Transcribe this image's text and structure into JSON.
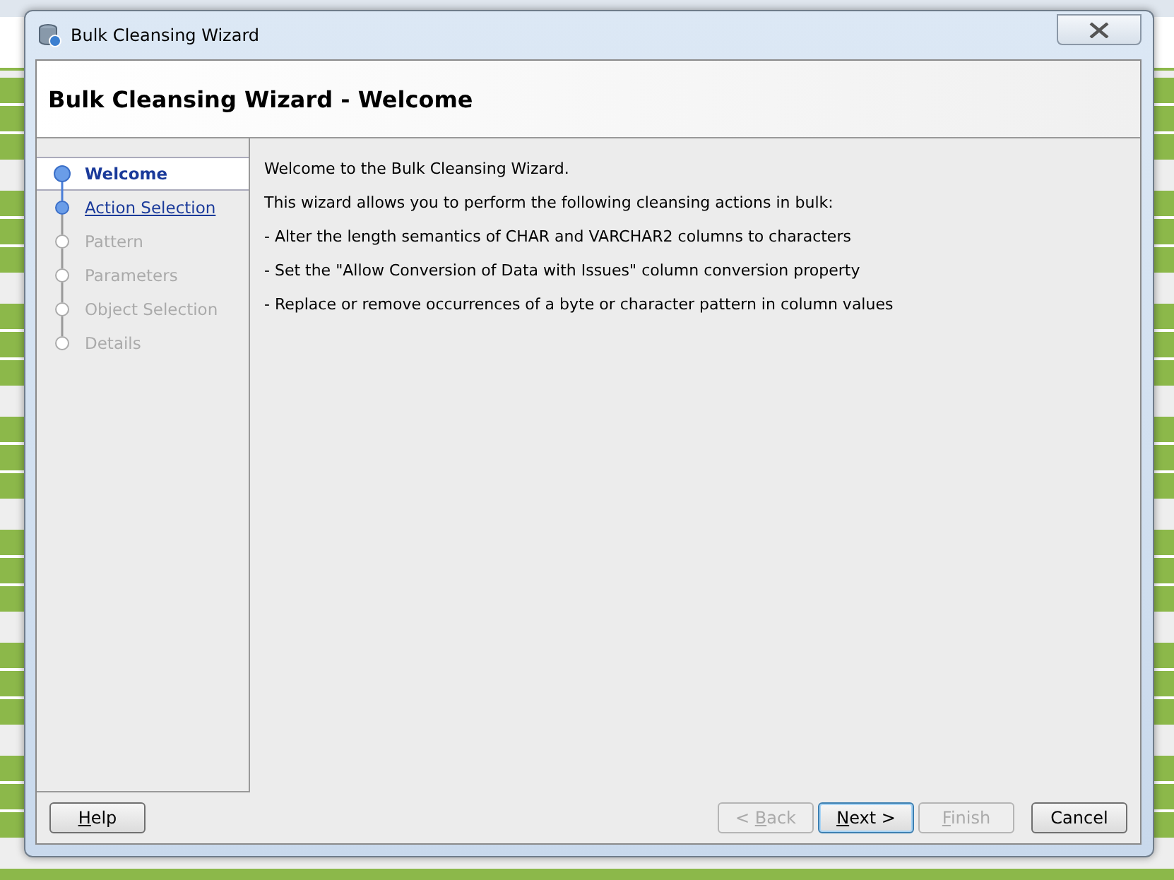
{
  "window": {
    "title": "Bulk Cleansing Wizard"
  },
  "header": {
    "title": "Bulk Cleansing Wizard - Welcome"
  },
  "steps": [
    {
      "label": "Welcome",
      "selected": true,
      "disabled": false
    },
    {
      "label": "Action Selection",
      "selected": false,
      "disabled": false
    },
    {
      "label": "Pattern",
      "selected": false,
      "disabled": true
    },
    {
      "label": "Parameters",
      "selected": false,
      "disabled": true
    },
    {
      "label": "Object Selection",
      "selected": false,
      "disabled": true
    },
    {
      "label": "Details",
      "selected": false,
      "disabled": true
    }
  ],
  "content": [
    "Welcome to the Bulk Cleansing Wizard.",
    "This wizard allows you to perform the following cleansing actions in bulk:",
    "- Alter the length semantics of CHAR and VARCHAR2 columns to characters",
    "- Set the \"Allow Conversion of Data with Issues\" column conversion property",
    "- Replace or remove occurrences of a byte or character pattern in column values"
  ],
  "help_button": {
    "key": "H",
    "after": "elp",
    "disabled": false
  },
  "buttons": [
    {
      "before": "< ",
      "key": "B",
      "after": "ack",
      "disabled": true,
      "default": false
    },
    {
      "key": "N",
      "after": "ext >",
      "disabled": false,
      "default": true
    },
    {
      "key": "F",
      "after": "inish",
      "disabled": true,
      "default": false
    },
    {
      "before": "Cancel",
      "disabled": false,
      "default": false
    }
  ]
}
